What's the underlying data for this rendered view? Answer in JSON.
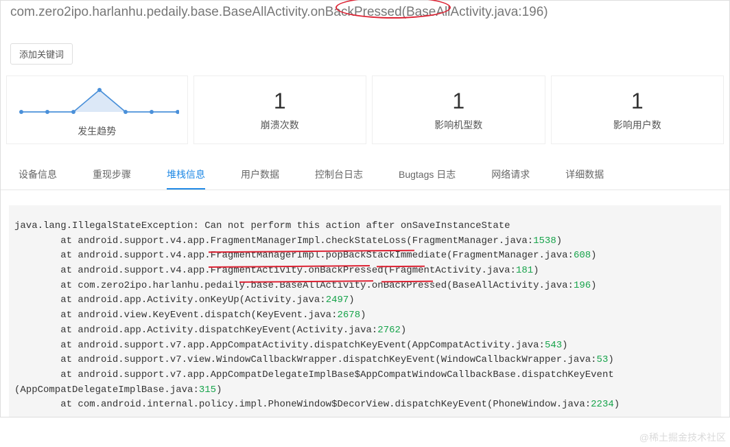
{
  "header": {
    "title": "com.zero2ipo.harlanhu.pedaily.base.BaseAllActivity.onBackPressed(BaseAllActivity.java:196)"
  },
  "keyword_btn": "添加关键词",
  "stats": {
    "trend_label": "发生趋势",
    "cards": [
      {
        "value": "1",
        "label": "崩溃次数"
      },
      {
        "value": "1",
        "label": "影响机型数"
      },
      {
        "value": "1",
        "label": "影响用户数"
      }
    ]
  },
  "tabs": [
    "设备信息",
    "重现步骤",
    "堆栈信息",
    "用户数据",
    "控制台日志",
    "Bugtags 日志",
    "网络请求",
    "详细数据"
  ],
  "active_tab_index": 2,
  "stack": {
    "exception": "java.lang.IllegalStateException: Can not perform this action after onSaveInstanceState",
    "lines": [
      {
        "text": "        at android.support.v4.app.FragmentManagerImpl.checkStateLoss(FragmentManager.java:",
        "ln": "1538",
        "tail": ")"
      },
      {
        "text": "        at android.support.v4.app.FragmentManagerImpl.popBackStackImmediate(FragmentManager.java:",
        "ln": "608",
        "tail": ")"
      },
      {
        "text": "        at android.support.v4.app.FragmentActivity.onBackPressed(FragmentActivity.java:",
        "ln": "181",
        "tail": ")"
      },
      {
        "text": "        at com.zero2ipo.harlanhu.pedaily.base.BaseAllActivity.onBackPressed(BaseAllActivity.java:",
        "ln": "196",
        "tail": ")"
      },
      {
        "text": "        at android.app.Activity.onKeyUp(Activity.java:",
        "ln": "2497",
        "tail": ")"
      },
      {
        "text": "        at android.view.KeyEvent.dispatch(KeyEvent.java:",
        "ln": "2678",
        "tail": ")"
      },
      {
        "text": "        at android.app.Activity.dispatchKeyEvent(Activity.java:",
        "ln": "2762",
        "tail": ")"
      },
      {
        "text": "        at android.support.v7.app.AppCompatActivity.dispatchKeyEvent(AppCompatActivity.java:",
        "ln": "543",
        "tail": ")"
      },
      {
        "text": "        at android.support.v7.view.WindowCallbackWrapper.dispatchKeyEvent(WindowCallbackWrapper.java:",
        "ln": "53",
        "tail": ")"
      },
      {
        "text": "        at android.support.v7.app.AppCompatDelegateImplBase$AppCompatWindowCallbackBase.dispatchKeyEvent",
        "ln": "",
        "tail": ""
      },
      {
        "text": "(AppCompatDelegateImplBase.java:",
        "ln": "315",
        "tail": ")",
        "nowrap": true
      },
      {
        "text": "        at com.android.internal.policy.impl.PhoneWindow$DecorView.dispatchKeyEvent(PhoneWindow.java:",
        "ln": "2234",
        "tail": ")"
      }
    ]
  },
  "watermark": "@稀土掘金技术社区",
  "chart_data": {
    "type": "line",
    "x": [
      0,
      1,
      2,
      3,
      4,
      5,
      6
    ],
    "values": [
      0,
      0,
      0,
      1,
      0,
      0,
      0
    ],
    "title": "发生趋势",
    "xlabel": "",
    "ylabel": "",
    "ylim": [
      0,
      1
    ]
  }
}
